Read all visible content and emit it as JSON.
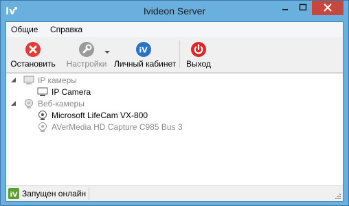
{
  "window": {
    "title": "Ivideon Server"
  },
  "menu": {
    "items": [
      "Общие",
      "Справка"
    ]
  },
  "toolbar": {
    "stop_label": "Остановить",
    "settings_label": "Настройки",
    "cabinet_label": "Личный кабинет",
    "exit_label": "Выход"
  },
  "tree": {
    "ip_group": "IP камеры",
    "ip_camera": "IP Camera",
    "web_group": "Веб-камеры",
    "lifecam": "Microsoft LifeCam VX-800",
    "avermedia": "AVerMedia HD Capture C985 Bus 3"
  },
  "status": {
    "text": "Запущен онлайн"
  },
  "colors": {
    "titlebar": "#6ab0de",
    "close": "#c7463e",
    "stop": "#e53935",
    "cabinet": "#2a72c5",
    "exit": "#e02424",
    "status_icon": "#5aa02c"
  },
  "icons": {
    "app": "ivideon-logo-icon",
    "stop": "stop-x-icon",
    "settings": "wrench-icon",
    "cabinet": "iv-profile-icon",
    "exit": "power-icon"
  }
}
